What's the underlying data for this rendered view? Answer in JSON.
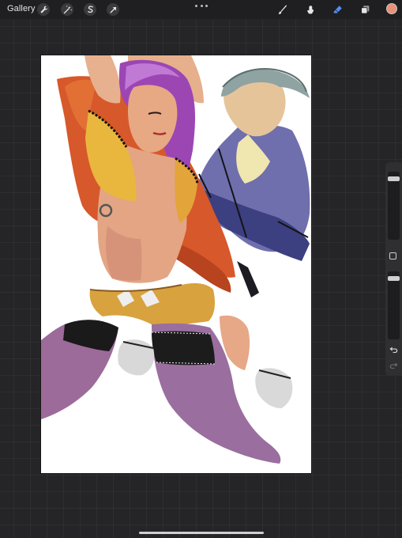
{
  "toolbar": {
    "gallery_label": "Gallery",
    "left_tools": [
      "wrench-icon",
      "magic-wand-icon",
      "selection-icon",
      "transform-arrow-icon"
    ],
    "right_tools": [
      "brush-icon",
      "smudge-icon",
      "eraser-icon",
      "layers-icon"
    ],
    "active_tool": "eraser",
    "active_tool_color": "#4f8ef7",
    "current_color": "#e8917a"
  },
  "sidebar": {
    "brush_size_level": 0.95,
    "opacity_level": 0.95,
    "buttons": [
      "modify-button",
      "undo-button",
      "redo-button"
    ]
  },
  "canvas": {
    "background": "#ffffff"
  }
}
